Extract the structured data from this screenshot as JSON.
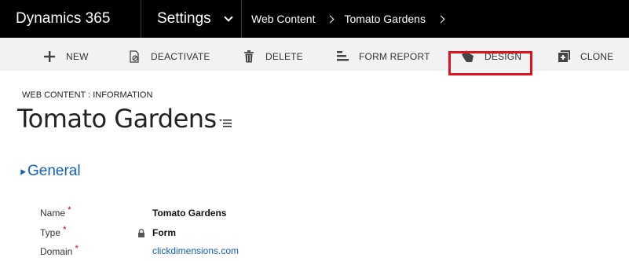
{
  "nav": {
    "app_name": "Dynamics 365",
    "area": "Settings",
    "breadcrumbs": [
      "Web Content",
      "Tomato Gardens"
    ]
  },
  "commands": [
    {
      "label": "NEW",
      "icon": "plus-icon"
    },
    {
      "label": "DEACTIVATE",
      "icon": "deactivate-icon"
    },
    {
      "label": "DELETE",
      "icon": "trash-icon"
    },
    {
      "label": "FORM REPORT",
      "icon": "report-icon"
    },
    {
      "label": "DESIGN",
      "icon": "design-hand-icon",
      "highlighted": true
    },
    {
      "label": "CLONE",
      "icon": "clone-icon"
    }
  ],
  "record": {
    "entity_form": "WEB CONTENT : INFORMATION",
    "title": "Tomato Gardens"
  },
  "section": {
    "title": "General",
    "fields": [
      {
        "label": "Name",
        "required": "*",
        "value": "Tomato Gardens"
      },
      {
        "label": "Type",
        "required": "*",
        "value": "Form",
        "locked": true
      },
      {
        "label": "Domain",
        "required": "*",
        "value": "clickdimensions.com",
        "link": true
      }
    ]
  },
  "colors": {
    "nav_bg": "#000000",
    "command_bar_bg": "#f2f2f2",
    "link_blue": "#1160b7",
    "required_red": "#c8102e",
    "highlight_red": "#e0131b"
  }
}
